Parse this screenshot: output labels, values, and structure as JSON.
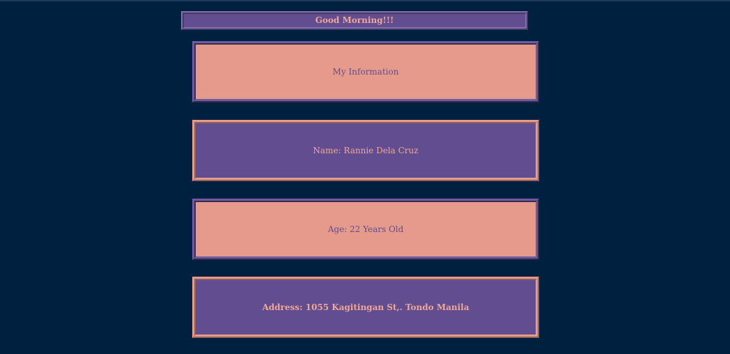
{
  "header": {
    "greeting": "Good Morning!!!"
  },
  "profile": {
    "section_title": "My Information",
    "name": "Name: Rannie Dela Cruz",
    "age": "Age: 22 Years Old",
    "address": "Address: 1055 Kagitingan St,. Tondo Manila"
  },
  "colors": {
    "background": "#00203f",
    "purple": "#614d8f",
    "salmon": "#e69a8b"
  }
}
